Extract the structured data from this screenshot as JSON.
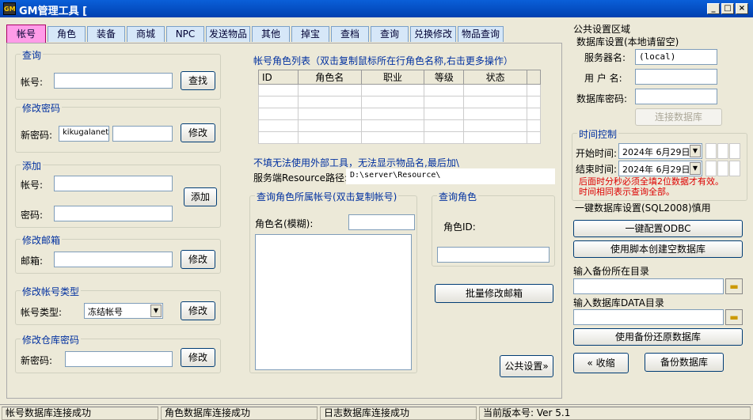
{
  "window": {
    "icon": "GM",
    "title": "GM管理工具 [",
    "min": "_",
    "max": "□",
    "close": "×"
  },
  "tabs": [
    "帐号",
    "角色",
    "装备",
    "商城",
    "NPC",
    "发送物品",
    "其他",
    "掉宝",
    "查档",
    "查询",
    "兑换修改",
    "物品查询"
  ],
  "query": {
    "title": "查询",
    "account_label": "帐号:",
    "account_value": "",
    "button": "查找"
  },
  "pwd": {
    "title": "修改密码",
    "label": "新密码:",
    "value1": "kikugalanet",
    "value2": "",
    "button": "修改"
  },
  "add": {
    "title": "添加",
    "account_label": "帐号:",
    "password_label": "密码:",
    "button": "添加"
  },
  "mail": {
    "title": "修改邮箱",
    "label": "邮箱:",
    "button": "修改"
  },
  "acctype": {
    "title": "修改帐号类型",
    "label": "帐号类型:",
    "selected": "冻结帐号",
    "button": "修改"
  },
  "warehouse": {
    "title": "修改仓库密码",
    "label": "新密码:",
    "button": "修改"
  },
  "rolelist": {
    "title": "帐号角色列表（双击复制鼠标所在行角色名称,右击更多操作）",
    "columns": [
      "ID",
      "角色名",
      "职业",
      "等级",
      "状态"
    ]
  },
  "resource": {
    "warning": "不填无法使用外部工具，无法显示物品名,最后加\\",
    "label": "服务端Resource路径:",
    "value": "D:\\server\\Resource\\"
  },
  "roleowner": {
    "title": "查询角色所属帐号(双击复制帐号)",
    "name_label": "角色名(模糊):"
  },
  "queryrole": {
    "title": "查询角色",
    "id_label": "角色ID:"
  },
  "batch_mail_button": "批量修改邮箱",
  "public_settings_button": "公共设置»",
  "right": {
    "title": "公共设置区域",
    "db_title": "数据库设置(本地请留空)",
    "server_label": "服务器名:",
    "server_value": "(local)",
    "user_label": "用 户 名:",
    "dbpwd_label": "数据库密码:",
    "connect_button": "连接数据库",
    "time_title": "时间控制",
    "start_label": "开始时间:",
    "start_value": "2024年 6月29日",
    "end_label": "结束时间:",
    "end_value": "2024年 6月29日",
    "time_note1": "后面时分秒必须全填2位数据才有效。",
    "time_note2": "时间相同表示查询全部。",
    "onekey_title": "一键数据库设置(SQL2008)慎用",
    "odbc_button": "一键配置ODBC",
    "script_button": "使用脚本创建空数据库",
    "backup_dir_label": "输入备份所在目录",
    "data_dir_label": "输入数据库DATA目录",
    "restore_button": "使用备份还原数据库",
    "collapse_button": "« 收缩",
    "backup_button": "备份数据库"
  },
  "status": [
    "帐号数据库连接成功",
    "角色数据库连接成功",
    "日志数据库连接成功",
    "当前版本号: Ver 5.1"
  ]
}
